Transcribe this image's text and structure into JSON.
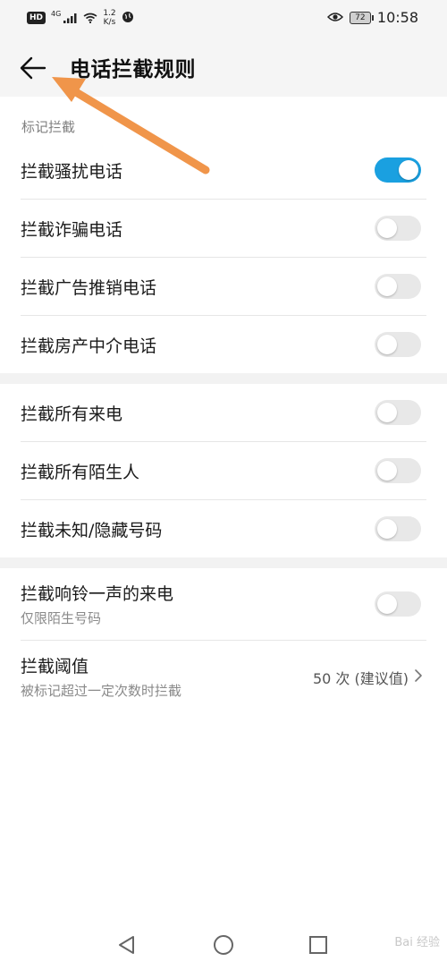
{
  "status_bar": {
    "hd": "HD",
    "network_type": "4G",
    "speed_value": "1.2",
    "speed_unit": "K/s",
    "battery": "72",
    "time": "10:58"
  },
  "app_bar": {
    "title": "电话拦截规则"
  },
  "section": {
    "label": "标记拦截"
  },
  "group1": [
    {
      "label": "拦截骚扰电话",
      "on": true
    },
    {
      "label": "拦截诈骗电话",
      "on": false
    },
    {
      "label": "拦截广告推销电话",
      "on": false
    },
    {
      "label": "拦截房产中介电话",
      "on": false
    }
  ],
  "group2": [
    {
      "label": "拦截所有来电",
      "on": false
    },
    {
      "label": "拦截所有陌生人",
      "on": false
    },
    {
      "label": "拦截未知/隐藏号码",
      "on": false
    }
  ],
  "group3": {
    "ring_once": {
      "label": "拦截响铃一声的来电",
      "sub": "仅限陌生号码",
      "on": false
    },
    "threshold": {
      "label": "拦截阈值",
      "sub": "被标记超过一定次数时拦截",
      "value": "50 次 (建议值)"
    }
  },
  "colors": {
    "accent": "#1aa0e0",
    "annotation_arrow": "#f0954a"
  },
  "watermark": "Bai 经验"
}
